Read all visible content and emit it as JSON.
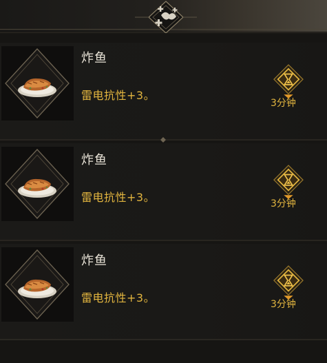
{
  "items": [
    {
      "name": "炸鱼",
      "effect": "雷电抗性+3。",
      "duration": "3分钟",
      "icon": "fried-fish-icon"
    },
    {
      "name": "炸鱼",
      "effect": "雷电抗性+3。",
      "duration": "3分钟",
      "icon": "fried-fish-icon"
    },
    {
      "name": "炸鱼",
      "effect": "雷电抗性+3。",
      "duration": "3分钟",
      "icon": "fried-fish-icon"
    }
  ],
  "colors": {
    "background": "#161513",
    "accent_gold": "#e2b53f",
    "title_text": "#e7e2d6",
    "frame_line": "#6e6452"
  }
}
